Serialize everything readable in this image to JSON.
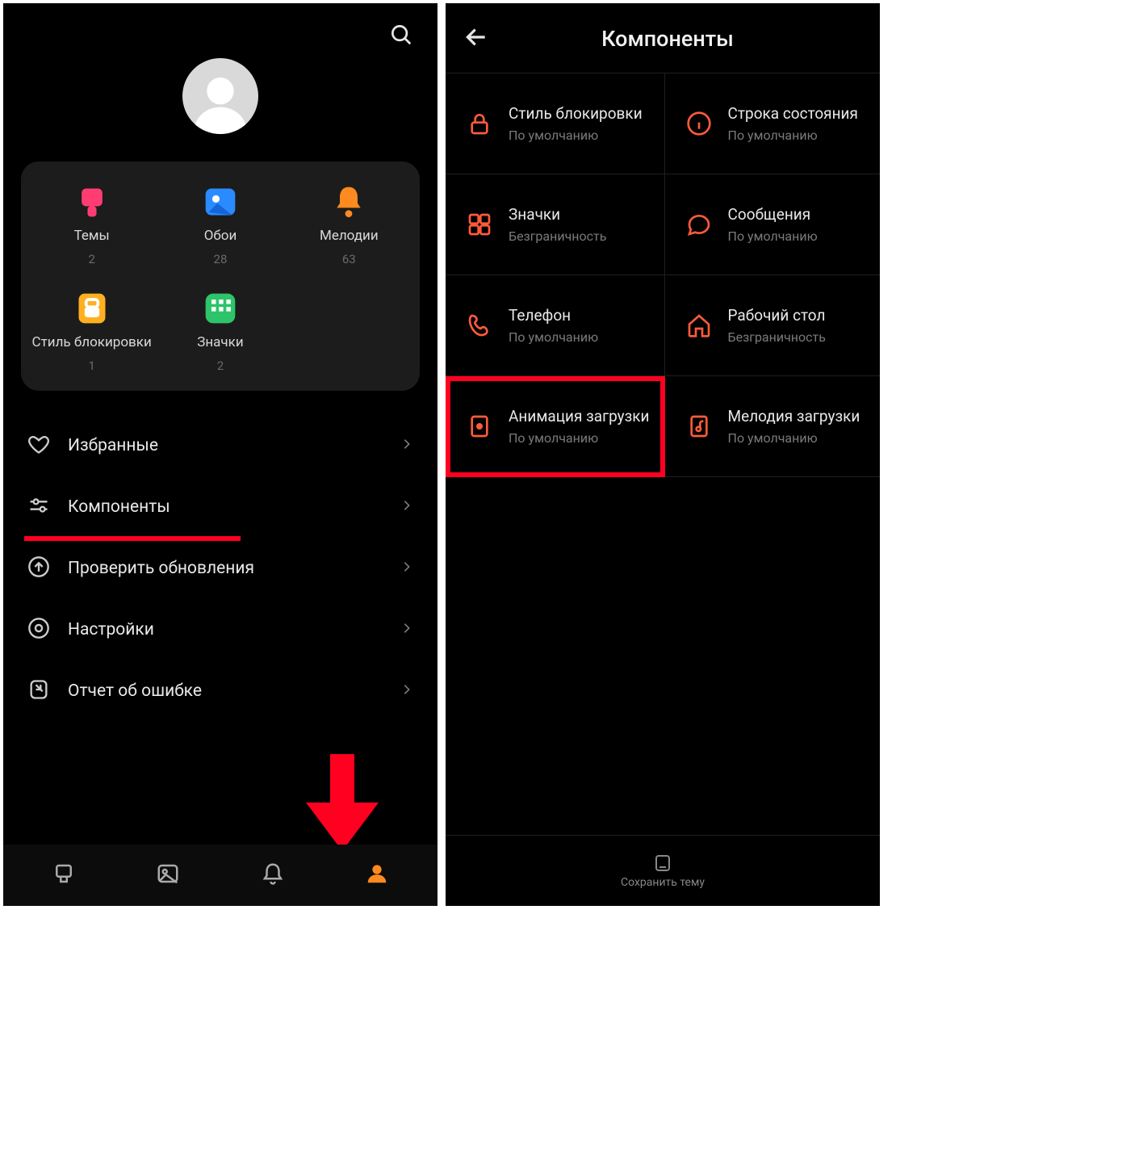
{
  "left": {
    "search_icon": "search",
    "grid": [
      {
        "icon": "theme",
        "label": "Темы",
        "count": "2"
      },
      {
        "icon": "wall",
        "label": "Обои",
        "count": "28"
      },
      {
        "icon": "ring",
        "label": "Мелодии",
        "count": "63"
      },
      {
        "icon": "lock",
        "label": "Стиль блокировки",
        "count": "1"
      },
      {
        "icon": "grid",
        "label": "Значки",
        "count": "2"
      }
    ],
    "menu": [
      {
        "icon": "heart",
        "label": "Избранные"
      },
      {
        "icon": "sliders",
        "label": "Компоненты",
        "highlight": true
      },
      {
        "icon": "up",
        "label": "Проверить обновления"
      },
      {
        "icon": "gear",
        "label": "Настройки"
      },
      {
        "icon": "report",
        "label": "Отчет об ошибке"
      }
    ],
    "nav_icons": [
      "brush",
      "picture",
      "bell",
      "profile"
    ]
  },
  "right": {
    "title": "Компоненты",
    "components": [
      {
        "icon": "lock",
        "title": "Стиль блокировки",
        "sub": "По умолчанию"
      },
      {
        "icon": "info",
        "title": "Строка состояния",
        "sub": "По умолчанию"
      },
      {
        "icon": "grid4",
        "title": "Значки",
        "sub": "Безграничность"
      },
      {
        "icon": "chat",
        "title": "Сообщения",
        "sub": "По умолчанию"
      },
      {
        "icon": "phone",
        "title": "Телефон",
        "sub": "По умолчанию"
      },
      {
        "icon": "home",
        "title": "Рабочий стол",
        "sub": "Безграничность"
      },
      {
        "icon": "anim",
        "title": "Анимация загрузки",
        "sub": "По умолчанию",
        "highlight": true
      },
      {
        "icon": "music",
        "title": "Мелодия загрузки",
        "sub": "По умолчанию"
      }
    ],
    "save_label": "Сохранить тему"
  }
}
